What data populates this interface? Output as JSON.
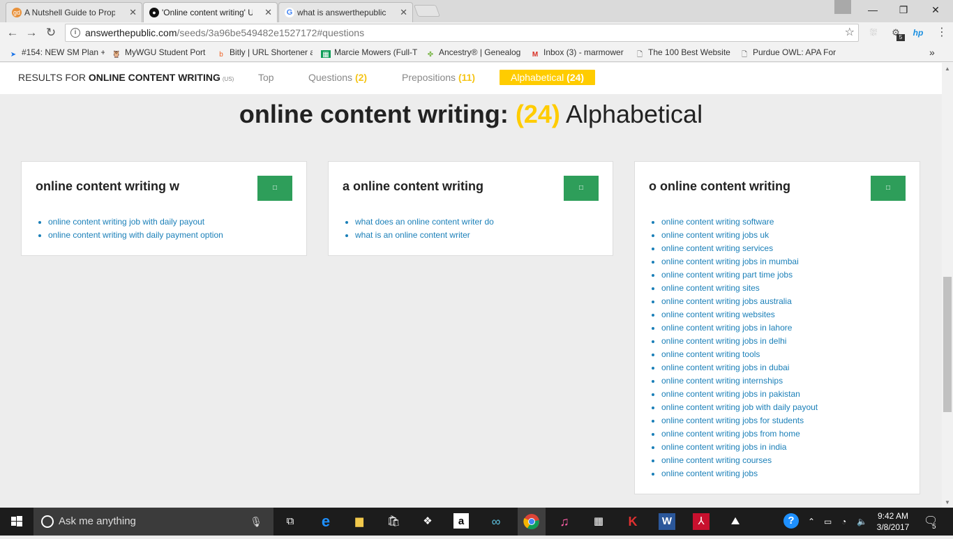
{
  "browser": {
    "tabs": [
      {
        "title": "A Nutshell Guide to Prop",
        "favicon_color": "#e8913a",
        "favicon_glyph": "gd"
      },
      {
        "title": "'Online content writing' U",
        "favicon_color": "#111111",
        "favicon_glyph": "●"
      },
      {
        "title": "what is answerthepublic",
        "favicon_color": "#4285f4",
        "favicon_glyph": "G"
      }
    ],
    "url_host": "answerthepublic.com",
    "url_path": "/seeds/3a96be549482e1527172#questions",
    "extension_badge": "5",
    "bookmarks": [
      {
        "label": "#154: NEW SM Plan +",
        "icon": "arrow-icon"
      },
      {
        "label": "MyWGU Student Port",
        "icon": "owl-icon"
      },
      {
        "label": "Bitly | URL Shortener a",
        "icon": "bitly-icon"
      },
      {
        "label": "Marcie Mowers (Full-T",
        "icon": "sheets-icon"
      },
      {
        "label": "Ancestry® | Genealog",
        "icon": "leaf-icon"
      },
      {
        "label": "Inbox (3) - marmower",
        "icon": "gmail-icon"
      },
      {
        "label": "The 100 Best Website",
        "icon": "page-icon"
      },
      {
        "label": "Purdue OWL: APA For",
        "icon": "page-icon"
      }
    ]
  },
  "results_nav": {
    "prefix": "RESULTS FOR ",
    "query": "ONLINE CONTENT WRITING",
    "region": "(US)",
    "tabs": [
      {
        "label": "Top ",
        "count": ""
      },
      {
        "label": "Questions ",
        "count": "(2)"
      },
      {
        "label": "Prepositions ",
        "count": "(11)"
      },
      {
        "label": "Alphabetical ",
        "count": "(24)"
      }
    ]
  },
  "heading": {
    "query": "online content writing:",
    "count": "(24)",
    "mode": "Alphabetical"
  },
  "cards": [
    {
      "title": "online content writing w",
      "button_glyph": "□",
      "items": [
        "online content writing job with daily payout",
        "online content writing with daily payment option"
      ]
    },
    {
      "title": "a online content writing",
      "button_glyph": "□",
      "items": [
        "what does an online content writer do",
        "what is an online content writer"
      ]
    },
    {
      "title": "o online content writing",
      "button_glyph": "□",
      "items": [
        "online content writing software",
        "online content writing jobs uk",
        "online content writing services",
        "online content writing jobs in mumbai",
        "online content writing part time jobs",
        "online content writing sites",
        "online content writing jobs australia",
        "online content writing websites",
        "online content writing jobs in lahore",
        "online content writing jobs in delhi",
        "online content writing tools",
        "online content writing jobs in dubai",
        "online content writing internships",
        "online content writing jobs in pakistan",
        "online content writing job with daily payout",
        "online content writing jobs for students",
        "online content writing jobs from home",
        "online content writing jobs in india",
        "online content writing courses",
        "online content writing jobs"
      ]
    }
  ],
  "taskbar": {
    "search_placeholder": "Ask me anything",
    "time": "9:42 AM",
    "date": "3/8/2017",
    "notification_count": "5"
  },
  "colors": {
    "accent_yellow": "#ffcc00",
    "button_green": "#2e9e5a",
    "link_blue": "#1a7fb8"
  }
}
